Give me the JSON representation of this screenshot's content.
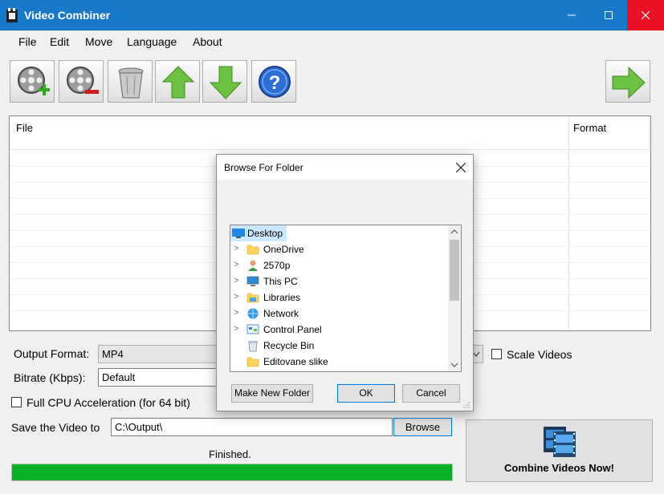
{
  "window": {
    "title": "Video Combiner"
  },
  "menu": [
    "File",
    "Edit",
    "Move",
    "Language",
    "About"
  ],
  "list": {
    "col_file": "File",
    "col_format": "Format"
  },
  "form": {
    "output_format_label": "Output Format:",
    "output_format_value": "MP4",
    "scale_videos_label": "Scale Videos",
    "bitrate_label": "Bitrate (Kbps):",
    "bitrate_value": "Default",
    "cpu_label": "Full CPU Acceleration (for 64 bit)",
    "save_label": "Save the Video to",
    "save_path": "C:\\Output\\",
    "browse_label": "Browse",
    "status": "Finished.",
    "progress": 1.0,
    "combine_label": "Combine Videos Now!"
  },
  "dialog": {
    "title": "Browse For Folder",
    "tree": [
      {
        "label": "Desktop",
        "icon": "desktop-icon",
        "selected": true,
        "expandable": false
      },
      {
        "label": "OneDrive",
        "icon": "folder-icon",
        "selected": false,
        "expandable": true
      },
      {
        "label": "2570p",
        "icon": "user-icon",
        "selected": false,
        "expandable": true
      },
      {
        "label": "This PC",
        "icon": "computer-icon",
        "selected": false,
        "expandable": true
      },
      {
        "label": "Libraries",
        "icon": "libraries-icon",
        "selected": false,
        "expandable": true
      },
      {
        "label": "Network",
        "icon": "network-icon",
        "selected": false,
        "expandable": true
      },
      {
        "label": "Control Panel",
        "icon": "control-panel-icon",
        "selected": false,
        "expandable": true
      },
      {
        "label": "Recycle Bin",
        "icon": "recycle-bin-icon",
        "selected": false,
        "expandable": false
      },
      {
        "label": "Editovane slike",
        "icon": "folder-icon",
        "selected": false,
        "expandable": false
      }
    ],
    "make_new_folder": "Make New Folder",
    "ok": "OK",
    "cancel": "Cancel"
  },
  "colors": {
    "titlebar": "#1979ca",
    "progress": "#06b025",
    "selection": "#cce8ff",
    "close": "#e81123"
  }
}
